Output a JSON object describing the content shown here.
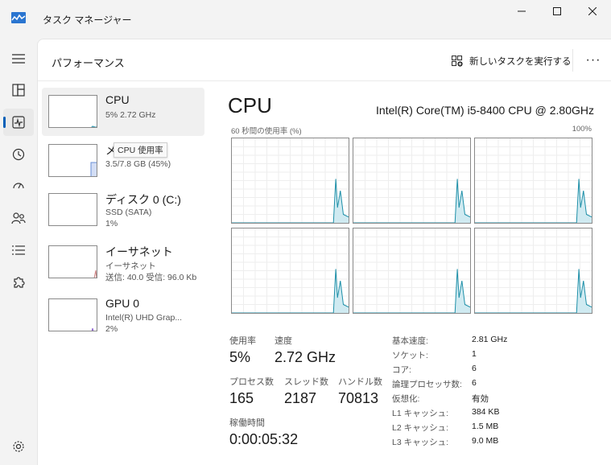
{
  "window": {
    "title": "タスク マネージャー"
  },
  "header": {
    "title": "パフォーマンス",
    "new_task_label": "新しいタスクを実行する",
    "more_label": "···"
  },
  "devices": [
    {
      "name": "CPU",
      "sub1": "5%  2.72 GHz",
      "sub2": ""
    },
    {
      "name": "メ",
      "sub1": "3.5/7.8 GB (45%)",
      "sub2": ""
    },
    {
      "name": "ディスク 0 (C:)",
      "sub1": "SSD (SATA)",
      "sub2": "1%"
    },
    {
      "name": "イーサネット",
      "sub1": "イーサネット",
      "sub2": "送信: 40.0  受信: 96.0 Kb"
    },
    {
      "name": "GPU 0",
      "sub1": "Intel(R) UHD Grap...",
      "sub2": "2%"
    }
  ],
  "tooltip": "CPU 使用率",
  "detail": {
    "title": "CPU",
    "model": "Intel(R) Core(TM) i5-8400 CPU @ 2.80GHz",
    "graph_left_label": "60 秒間の使用率 (%)",
    "graph_right_label": "100%",
    "utilization_label": "使用率",
    "utilization": "5%",
    "speed_label": "速度",
    "speed": "2.72 GHz",
    "processes_label": "プロセス数",
    "processes": "165",
    "threads_label": "スレッド数",
    "threads": "2187",
    "handles_label": "ハンドル数",
    "handles": "70813",
    "uptime_label": "稼働時間",
    "uptime": "0:00:05:32"
  },
  "specs": [
    {
      "label": "基本速度:",
      "value": "2.81 GHz"
    },
    {
      "label": "ソケット:",
      "value": "1"
    },
    {
      "label": "コア:",
      "value": "6"
    },
    {
      "label": "論理プロセッサ数:",
      "value": "6"
    },
    {
      "label": "仮想化:",
      "value": "有効"
    },
    {
      "label": "L1 キャッシュ:",
      "value": "384 KB"
    },
    {
      "label": "L2 キャッシュ:",
      "value": "1.5 MB"
    },
    {
      "label": "L3 キャッシュ:",
      "value": "9.0 MB"
    }
  ],
  "colors": {
    "cpu": "#1d8fa8",
    "cpu_fill": "#cfeaf1",
    "memory": "#6a8fd6",
    "ethernet": "#c77c7c",
    "gpu": "#8a5fcf",
    "accent": "#005fb8"
  }
}
